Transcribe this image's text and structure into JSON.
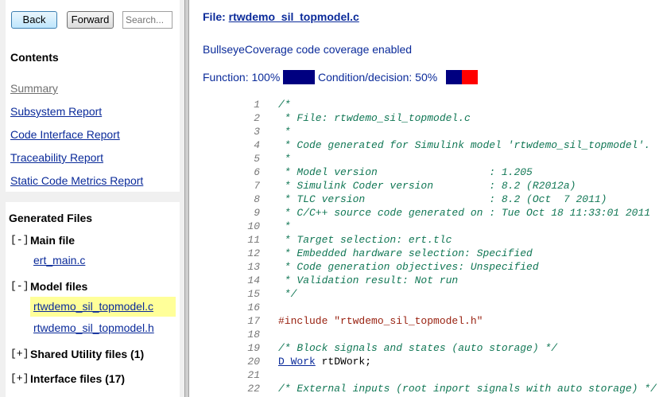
{
  "nav": {
    "back": "Back",
    "forward": "Forward",
    "search_placeholder": "Search..."
  },
  "contents": {
    "title": "Contents",
    "links": [
      "Summary",
      "Subsystem Report",
      "Code Interface Report",
      "Traceability Report",
      "Static Code Metrics Report"
    ]
  },
  "generated": {
    "title": "Generated Files",
    "groups": [
      {
        "toggle": "[-]",
        "label": "Main file",
        "files": [
          "ert_main.c"
        ]
      },
      {
        "toggle": "[-]",
        "label": "Model files",
        "files": [
          "rtwdemo_sil_topmodel.c",
          "rtwdemo_sil_topmodel.h"
        ]
      },
      {
        "toggle": "[+]",
        "label": "Shared Utility files (1)",
        "files": []
      },
      {
        "toggle": "[+]",
        "label": "Interface files (17)",
        "files": []
      }
    ]
  },
  "main": {
    "file_label": "File:",
    "file_name": "rtwdemo_sil_topmodel.c",
    "coverage_msg": "BullseyeCoverage code coverage enabled",
    "function_label": "Function: 100%",
    "condition_label": "Condition/decision: 50%",
    "function_pct": 100,
    "condition_pct": 50,
    "colors": {
      "covered": "#000080",
      "uncovered": "#ff0000",
      "link": "#0b2b9a",
      "highlight": "#ffff99"
    }
  },
  "code_lines": [
    {
      "n": "1",
      "t": "/*"
    },
    {
      "n": "2",
      "t": " * File: rtwdemo_sil_topmodel.c"
    },
    {
      "n": "3",
      "t": " *"
    },
    {
      "n": "4",
      "t": " * Code generated for Simulink model 'rtwdemo_sil_topmodel'."
    },
    {
      "n": "5",
      "t": " *"
    },
    {
      "n": "6",
      "t": " * Model version                  : 1.205"
    },
    {
      "n": "7",
      "t": " * Simulink Coder version         : 8.2 (R2012a)"
    },
    {
      "n": "8",
      "t": " * TLC version                    : 8.2 (Oct  7 2011)"
    },
    {
      "n": "9",
      "t": " * C/C++ source code generated on : Tue Oct 18 11:33:01 2011"
    },
    {
      "n": "10",
      "t": " *"
    },
    {
      "n": "11",
      "t": " * Target selection: ert.tlc"
    },
    {
      "n": "12",
      "t": " * Embedded hardware selection: Specified"
    },
    {
      "n": "13",
      "t": " * Code generation objectives: Unspecified"
    },
    {
      "n": "14",
      "t": " * Validation result: Not run"
    },
    {
      "n": "15",
      "t": " */"
    },
    {
      "n": "16",
      "t": ""
    },
    {
      "n": "17",
      "t": "#include \"rtwdemo_sil_topmodel.h\""
    },
    {
      "n": "18",
      "t": ""
    },
    {
      "n": "19",
      "t": "/* Block signals and states (auto storage) */"
    },
    {
      "n": "20",
      "link": "D_Work",
      "rest": " rtDWork;"
    },
    {
      "n": "21",
      "t": ""
    },
    {
      "n": "22",
      "t": "/* External inputs (root inport signals with auto storage) */"
    }
  ]
}
